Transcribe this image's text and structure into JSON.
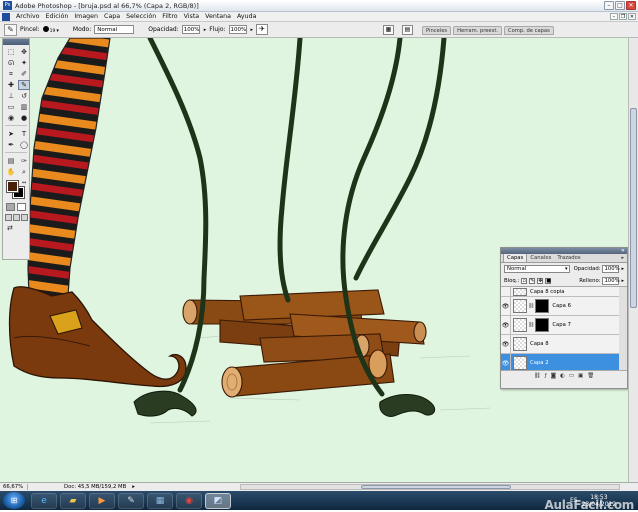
{
  "window": {
    "title": "Adobe Photoshop - [bruja.psd al 66,7% (Capa 2, RGB/8)]"
  },
  "menu": [
    "Archivo",
    "Edición",
    "Imagen",
    "Capa",
    "Selección",
    "Filtro",
    "Vista",
    "Ventana",
    "Ayuda"
  ],
  "options": {
    "brush_label": "Pincel:",
    "brush_size": "19",
    "mode_label": "Modo:",
    "mode_value": "Normal",
    "opacity_label": "Opacidad:",
    "opacity_value": "100%",
    "flow_label": "Flujo:",
    "flow_value": "100%"
  },
  "palette_well": [
    "Pinceles",
    "Herram. preest.",
    "Comp. de capas"
  ],
  "layers_panel": {
    "tabs": [
      "Capas",
      "Canales",
      "Trazados"
    ],
    "blend_mode": "Normal",
    "opacity_label": "Opacidad:",
    "opacity_value": "100%",
    "lock_label": "Bloq.:",
    "fill_label": "Relleno:",
    "fill_value": "100%",
    "layers": [
      {
        "name": "Capa 8 copia"
      },
      {
        "name": "Capa 6"
      },
      {
        "name": "Capa 7"
      },
      {
        "name": "Capa 8"
      },
      {
        "name": "Capa 2"
      }
    ]
  },
  "status": {
    "zoom": "66,67%",
    "doc": "Doc: 45,5 MB/159,2 MB"
  },
  "taskbar": {
    "lang": "ES",
    "time": "18:53",
    "date": "23/04/2012"
  },
  "watermark": "AulaFacil.com",
  "colors": {
    "foreground": "#4a2008",
    "background": "#000000",
    "canvas": "#dff5df",
    "selection": "#3d8fe0"
  }
}
